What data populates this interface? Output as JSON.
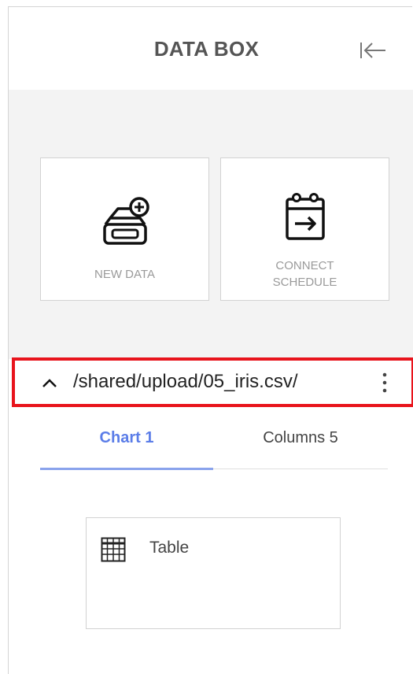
{
  "header": {
    "title": "DATA BOX",
    "collapse_icon": "collapse-left-icon"
  },
  "actions": {
    "new_data": {
      "label": "NEW DATA",
      "icon": "add-database-icon"
    },
    "connect_schedule": {
      "label_line1": "CONNECT",
      "label_line2": "SCHEDULE",
      "icon": "calendar-arrow-icon"
    }
  },
  "dataset": {
    "path": "/shared/upload/05_iris.csv/",
    "expand_icon": "chevron-up-icon",
    "menu_icon": "kebab-menu-icon"
  },
  "tabs": [
    {
      "label": "Chart 1",
      "active": true
    },
    {
      "label": "Columns 5",
      "active": false
    }
  ],
  "charts": [
    {
      "label": "Table",
      "icon": "table-grid-icon"
    }
  ],
  "colors": {
    "highlight_border": "#e8141c",
    "active_tab": "#5b7de8",
    "tab_underline": "#8aa3ec",
    "gray_background": "#f3f3f3"
  }
}
